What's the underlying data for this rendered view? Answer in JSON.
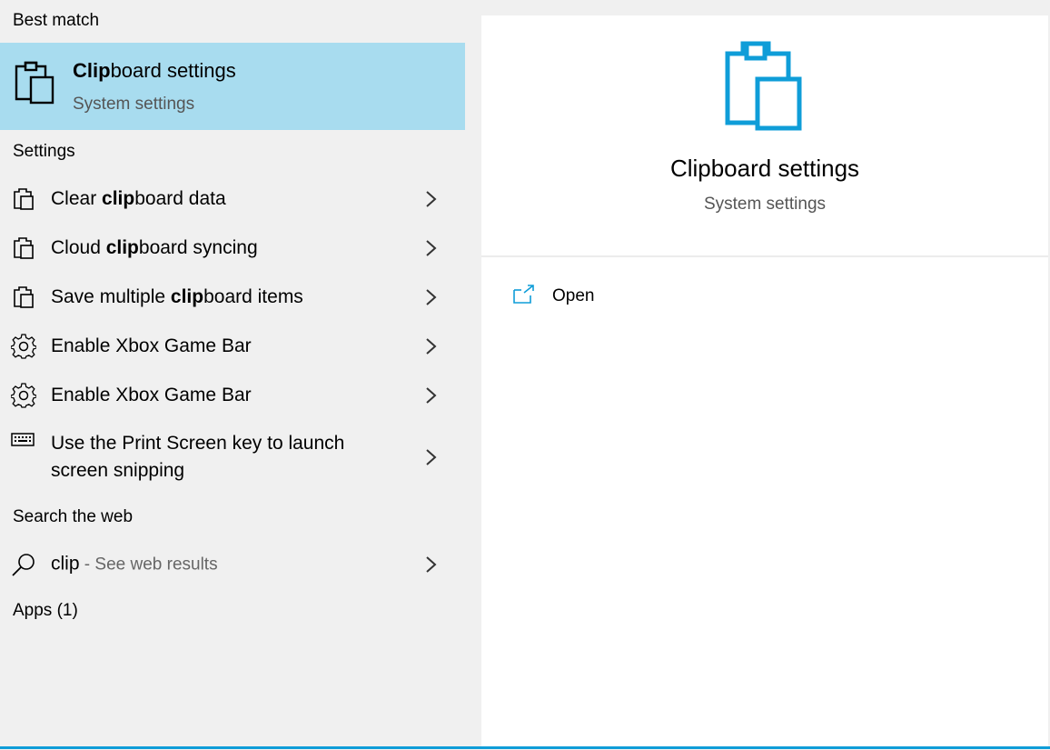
{
  "sections": {
    "best_match": "Best match",
    "settings": "Settings",
    "search_web": "Search the web",
    "apps": "Apps (1)"
  },
  "best_match": {
    "title_bold": "Clip",
    "title_rest": "board settings",
    "subtitle": "System settings",
    "icon": "clipboard-icon",
    "highlight_color": "#a8dcef"
  },
  "settings_items": [
    {
      "pre": "Clear ",
      "bold": "clip",
      "post": "board data",
      "icon": "clipboard-icon"
    },
    {
      "pre": "Cloud ",
      "bold": "clip",
      "post": "board syncing",
      "icon": "clipboard-icon"
    },
    {
      "pre": "Save multiple ",
      "bold": "clip",
      "post": "board items",
      "icon": "clipboard-icon"
    },
    {
      "pre": "Enable Xbox Game Bar",
      "bold": "",
      "post": "",
      "icon": "gear-icon"
    },
    {
      "pre": "Enable Xbox Game Bar",
      "bold": "",
      "post": "",
      "icon": "gear-icon"
    },
    {
      "pre": "Use the Print Screen key to launch screen snipping",
      "bold": "",
      "post": "",
      "icon": "keyboard-icon"
    }
  ],
  "web_search": {
    "query": "clip",
    "suffix": " - See web results",
    "icon": "search-icon"
  },
  "preview": {
    "title": "Clipboard settings",
    "subtitle": "System settings",
    "action_label": "Open",
    "accent": "#0f9dd8"
  }
}
